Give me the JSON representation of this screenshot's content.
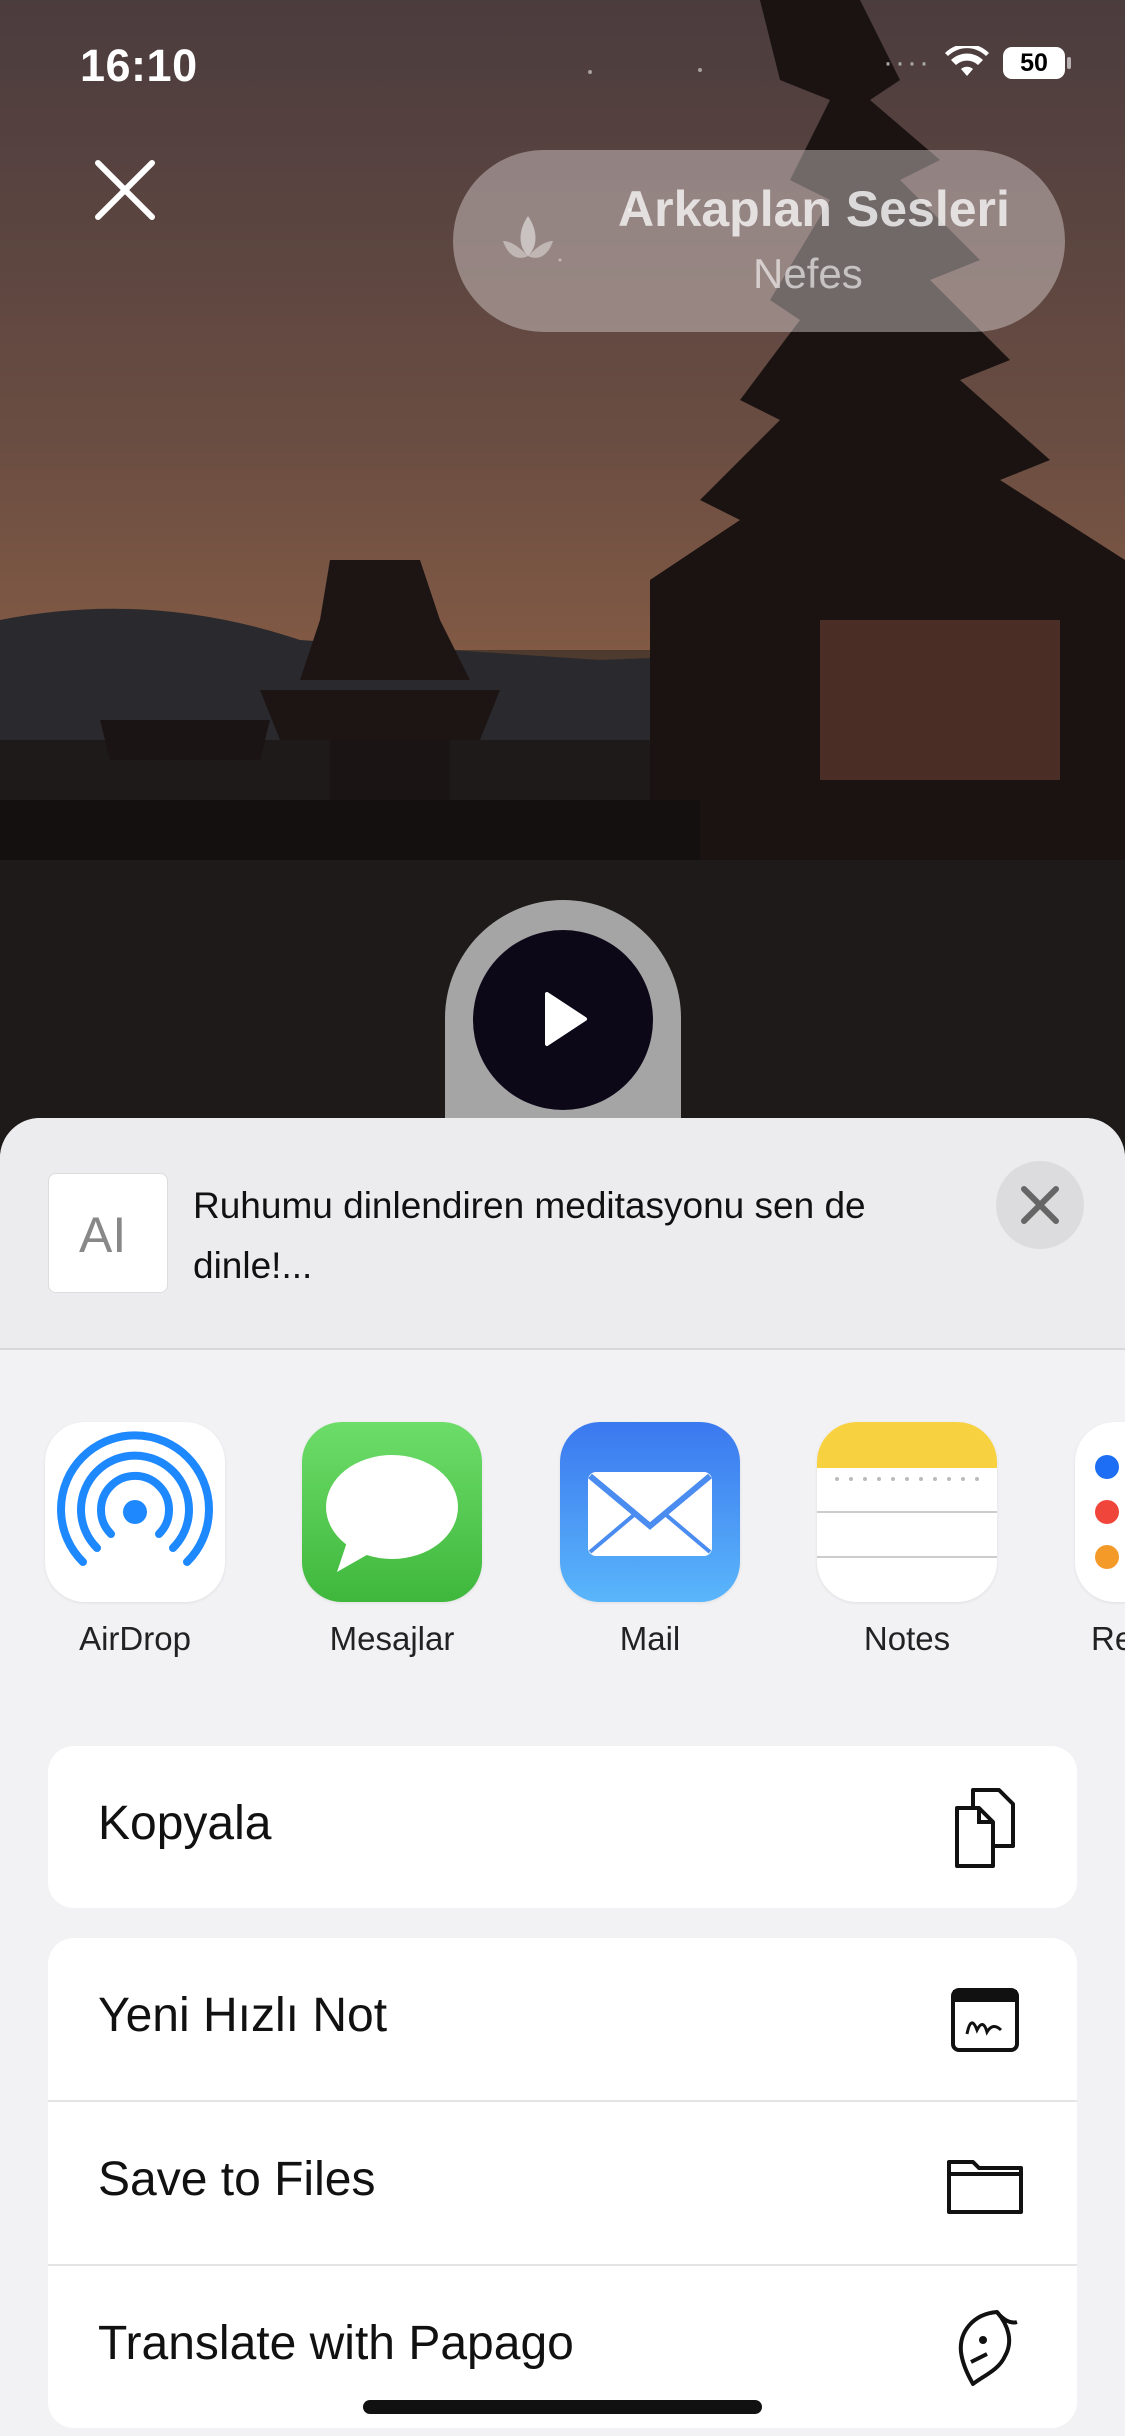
{
  "status_bar": {
    "time": "16:10",
    "battery": "50"
  },
  "header_pill": {
    "title": "Arkaplan Sesleri",
    "subtitle": "Nefes"
  },
  "share_sheet": {
    "preview_text": "Ruhumu dinlendiren meditasyonu sen de dinle!...",
    "preview_icon_text": "AI",
    "apps": [
      {
        "label": "AirDrop",
        "icon": "airdrop-icon"
      },
      {
        "label": "Mesajlar",
        "icon": "messages-icon"
      },
      {
        "label": "Mail",
        "icon": "mail-icon"
      },
      {
        "label": "Notes",
        "icon": "notes-icon"
      },
      {
        "label": "Rem",
        "icon": "reminders-icon"
      }
    ],
    "actions_group1": [
      {
        "label": "Kopyala",
        "icon": "copy-icon"
      }
    ],
    "actions_group2": [
      {
        "label": "Yeni Hızlı Not",
        "icon": "quick-note-icon"
      },
      {
        "label": "Save to Files",
        "icon": "folder-icon"
      },
      {
        "label": "Translate with Papago",
        "icon": "papago-icon"
      }
    ]
  },
  "colors": {
    "play_button": "#0c0818",
    "mail_blue": "#2f7cf6",
    "messages_green": "#4cd964",
    "airdrop_blue": "#1e88ff"
  }
}
